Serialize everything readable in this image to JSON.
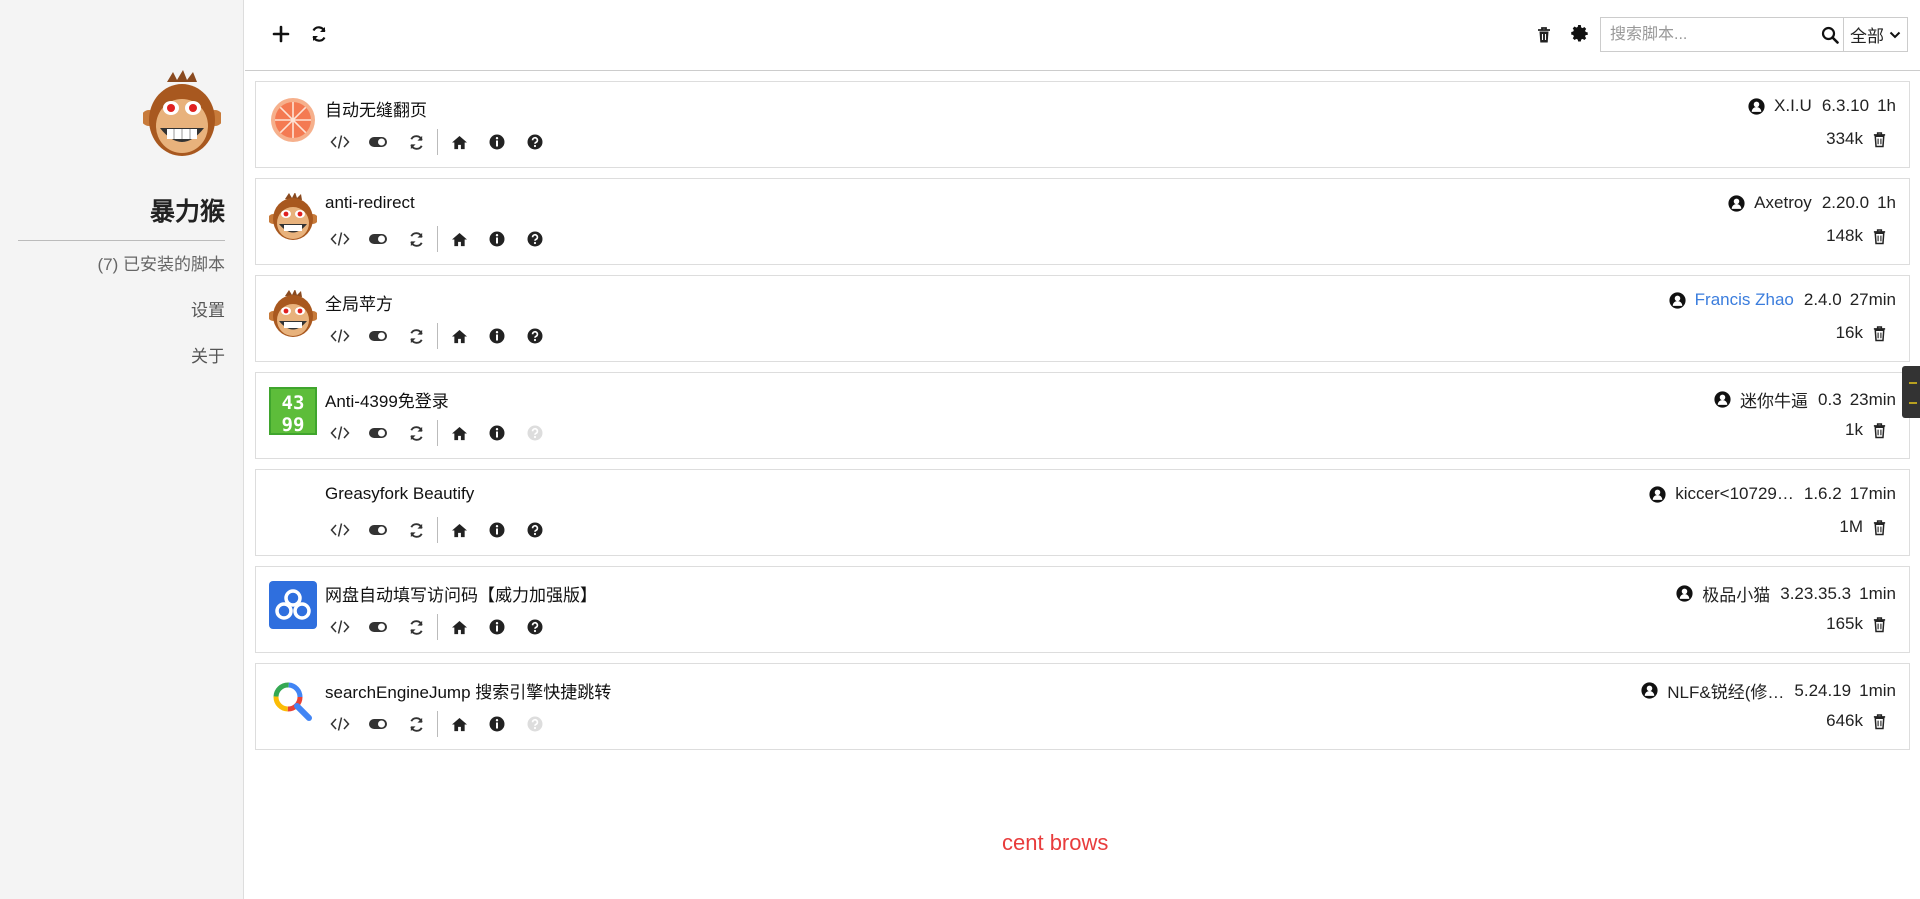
{
  "sidebar": {
    "brand": "暴力猴",
    "nav": [
      {
        "label": "(7) 已安装的脚本"
      },
      {
        "label": "设置"
      },
      {
        "label": "关于"
      }
    ]
  },
  "toolbar": {
    "search_placeholder": "搜索脚本...",
    "search_value": "",
    "filter_value": "全部"
  },
  "scripts": [
    {
      "name": "自动无缝翻页",
      "author": "X.I.U",
      "version": "6.3.10",
      "updated": "1h",
      "size": "334k",
      "icon": "grapefruit-icon",
      "help_enabled": true
    },
    {
      "name": "anti-redirect",
      "author": "Axetroy",
      "version": "2.20.0",
      "updated": "1h",
      "size": "148k",
      "icon": "monkey-icon",
      "help_enabled": true
    },
    {
      "name": "全局苹方",
      "author": "Francis Zhao",
      "version": "2.4.0",
      "updated": "27min",
      "size": "16k",
      "icon": "monkey-icon",
      "help_enabled": true,
      "author_link": true
    },
    {
      "name": "Anti-4399免登录",
      "author": "迷你牛逼",
      "version": "0.3",
      "updated": "23min",
      "size": "1k",
      "icon": "4399-icon",
      "help_enabled": false
    },
    {
      "name": "Greasyfork Beautify",
      "author": "kiccer<10729…",
      "version": "1.6.2",
      "updated": "17min",
      "size": "1M",
      "icon": "",
      "help_enabled": true
    },
    {
      "name": "网盘自动填写访问码【威力加强版】",
      "author": "极品小猫",
      "version": "3.23.35.3",
      "updated": "1min",
      "size": "165k",
      "icon": "baidu-cloud-icon",
      "help_enabled": true
    },
    {
      "name": "searchEngineJump 搜索引擎快捷跳转",
      "author": "NLF&锐经(修…",
      "version": "5.24.19",
      "updated": "1min",
      "size": "646k",
      "icon": "magnifier-icon",
      "help_enabled": false
    }
  ],
  "overlay_text": "cent brows",
  "colors": {
    "link": "#3b7ddd",
    "overlay": "#e83c3c",
    "sidebar_bg": "#f4f4f4"
  }
}
